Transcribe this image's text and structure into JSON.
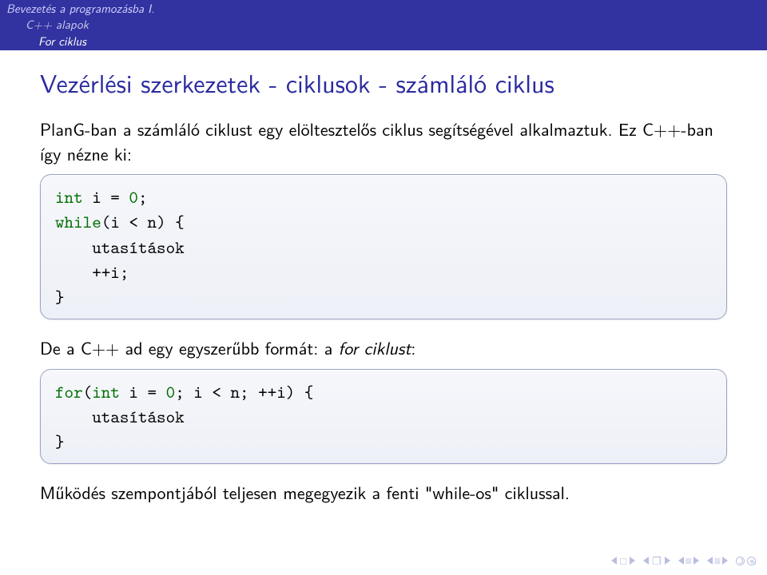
{
  "header": {
    "line1": "Bevezetés a programozásba I.",
    "line2": "C++ alapok",
    "line3": "For ciklus"
  },
  "title": "Vezérlési szerkezetek - ciklusok - számláló ciklus",
  "para1_a": "PlanG-ban a számláló ciklust egy elöltesztelős ciklus segítségével alkalmaztuk. Ez C++-ban így nézne ki:",
  "code1": {
    "l1a": "int",
    "l1b": " i = ",
    "l1c": "0",
    "l1d": ";",
    "l2a": "while",
    "l2b": "(i < n) {",
    "l3": "    utasítások",
    "l4": "    ++i;",
    "l5": "}"
  },
  "para2_a": "De a C++ ad egy egyszerűbb formát: a ",
  "para2_b": "for ciklust",
  "para2_c": ":",
  "code2": {
    "l1a": "for",
    "l1b": "(",
    "l1c": "int",
    "l1d": " i = ",
    "l1e": "0",
    "l1f": "; i < n; ++i) {",
    "l2": "    utasítások",
    "l3": "}"
  },
  "para3": "Működés szempontjából teljesen megegyezik a fenti \"while-os\" ciklussal.",
  "nav": {
    "sq": "□",
    "doc": "❐",
    "equiv1": "≡",
    "equiv2": "≡"
  }
}
